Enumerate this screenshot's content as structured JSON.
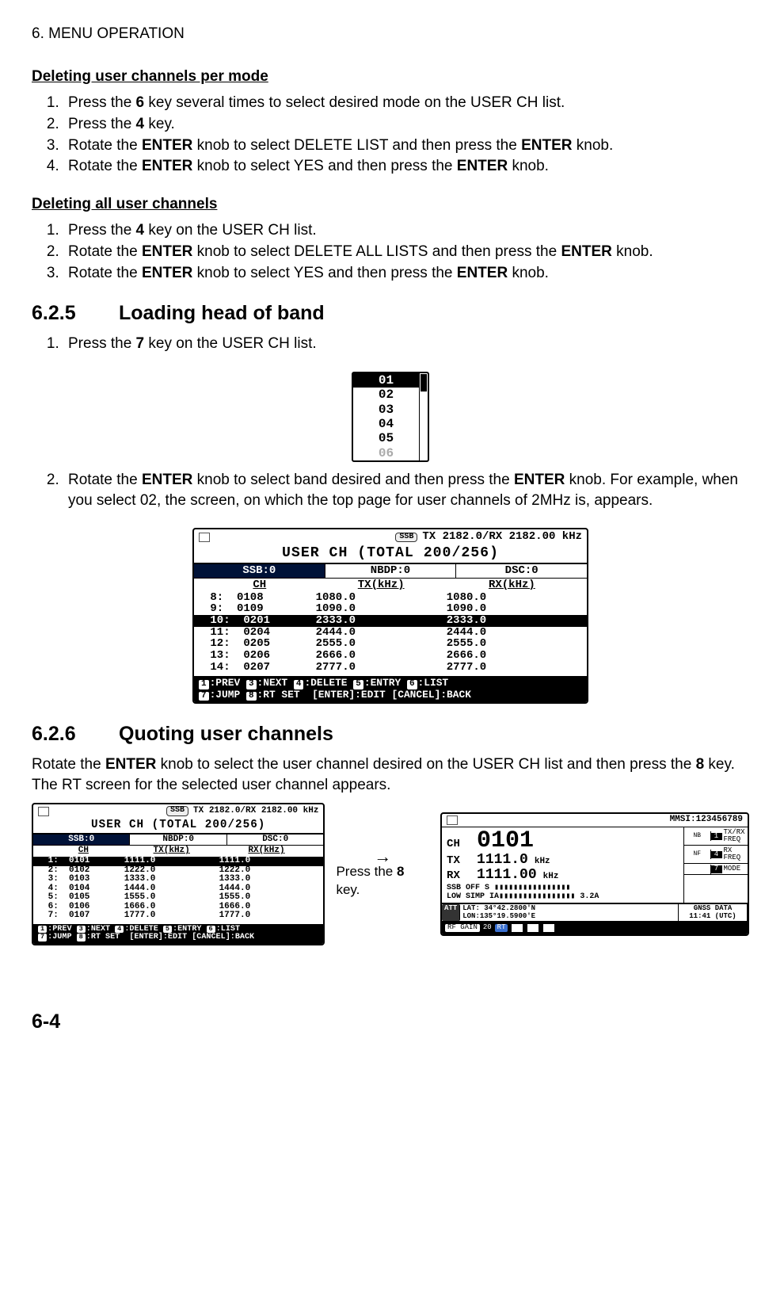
{
  "header": {
    "chapter": "6. MENU OPERATION"
  },
  "sec_per_mode": {
    "title": "Deleting user channels per mode",
    "steps": [
      "Press the <b>6</b> key several times to select desired mode on the USER CH list.",
      "Press the <b>4</b> key.",
      "Rotate the <b>ENTER</b> knob to select DELETE LIST and then press the <b>ENTER</b> knob.",
      "Rotate the <b>ENTER</b> knob to select YES and then press the <b>ENTER</b> knob."
    ]
  },
  "sec_all": {
    "title": "Deleting all user channels",
    "steps": [
      "Press the <b>4</b> key on the USER CH list.",
      "Rotate the <b>ENTER</b> knob to select DELETE ALL LISTS and then press the <b>ENTER</b> knob.",
      "Rotate the <b>ENTER</b> knob to select YES and then press the <b>ENTER</b> knob."
    ]
  },
  "sec_625": {
    "num": "6.2.5",
    "title": "Loading head of band",
    "step1": "Press the <b>7</b> key on the USER CH list.",
    "band_list": [
      "01",
      "02",
      "03",
      "04",
      "05",
      "06"
    ],
    "step2": "Rotate the <b>ENTER</b> knob to select band desired and then press the <b>ENTER</b> knob. For example, when you select 02, the screen, on which the top page for user channels of 2MHz is, appears."
  },
  "lcd_main": {
    "mode_badge": "SSB",
    "topline": "TX 2182.0/RX 2182.00 kHz",
    "title": "USER CH  (TOTAL 200/256)",
    "tabs": [
      "SSB:0",
      "NBDP:0",
      "DSC:0"
    ],
    "headers": [
      "CH",
      "TX(kHz)",
      "RX(kHz)"
    ],
    "rows": [
      {
        "idx": "8:",
        "ch": "0108",
        "tx": "1080.0",
        "rx": "1080.0",
        "sel": false
      },
      {
        "idx": "9:",
        "ch": "0109",
        "tx": "1090.0",
        "rx": "1090.0",
        "sel": false
      },
      {
        "idx": "10:",
        "ch": "0201",
        "tx": "2333.0",
        "rx": "2333.0",
        "sel": true
      },
      {
        "idx": "11:",
        "ch": "0204",
        "tx": "2444.0",
        "rx": "2444.0",
        "sel": false
      },
      {
        "idx": "12:",
        "ch": "0205",
        "tx": "2555.0",
        "rx": "2555.0",
        "sel": false
      },
      {
        "idx": "13:",
        "ch": "0206",
        "tx": "2666.0",
        "rx": "2666.0",
        "sel": false
      },
      {
        "idx": "14:",
        "ch": "0207",
        "tx": "2777.0",
        "rx": "2777.0",
        "sel": false
      }
    ],
    "footer1": [
      [
        "1",
        "PREV"
      ],
      [
        "3",
        "NEXT"
      ],
      [
        "4",
        "DELETE"
      ],
      [
        "5",
        "ENTRY"
      ],
      [
        "6",
        "LIST"
      ]
    ],
    "footer2_a": [
      [
        "7",
        "JUMP"
      ],
      [
        "8",
        "RT SET"
      ]
    ],
    "footer2_b": "[ENTER]:EDIT  [CANCEL]:BACK"
  },
  "sec_626": {
    "num": "6.2.6",
    "title": "Quoting user channels",
    "intro": "Rotate the <b>ENTER</b> knob to select the user channel desired on the USER CH list and then press the <b>8</b> key. The RT screen for the selected user channel appears."
  },
  "lcd_small": {
    "mode_badge": "SSB",
    "topline": "TX 2182.0/RX 2182.00 kHz",
    "title": "USER CH  (TOTAL 200/256)",
    "tabs": [
      "SSB:0",
      "NBDP:0",
      "DSC:0"
    ],
    "headers": [
      "CH",
      "TX(kHz)",
      "RX(kHz)"
    ],
    "rows": [
      {
        "idx": "1:",
        "ch": "0101",
        "tx": "1111.0",
        "rx": "1111.0",
        "sel": true
      },
      {
        "idx": "2:",
        "ch": "0102",
        "tx": "1222.0",
        "rx": "1222.0",
        "sel": false
      },
      {
        "idx": "3:",
        "ch": "0103",
        "tx": "1333.0",
        "rx": "1333.0",
        "sel": false
      },
      {
        "idx": "4:",
        "ch": "0104",
        "tx": "1444.0",
        "rx": "1444.0",
        "sel": false
      },
      {
        "idx": "5:",
        "ch": "0105",
        "tx": "1555.0",
        "rx": "1555.0",
        "sel": false
      },
      {
        "idx": "6:",
        "ch": "0106",
        "tx": "1666.0",
        "rx": "1666.0",
        "sel": false
      },
      {
        "idx": "7:",
        "ch": "0107",
        "tx": "1777.0",
        "rx": "1777.0",
        "sel": false
      }
    ],
    "footer1": [
      [
        "1",
        "PREV"
      ],
      [
        "3",
        "NEXT"
      ],
      [
        "4",
        "DELETE"
      ],
      [
        "5",
        "ENTRY"
      ],
      [
        "6",
        "LIST"
      ]
    ],
    "footer2_a": [
      [
        "7",
        "JUMP"
      ],
      [
        "8",
        "RT SET"
      ]
    ],
    "footer2_b": "[ENTER]:EDIT  [CANCEL]:BACK"
  },
  "arrow_text": "Press the <b>8</b> key.",
  "rt_screen": {
    "mmsi": "MMSI:123456789",
    "ch_label": "CH",
    "ch": "0101",
    "tx_label": "TX",
    "tx": "1111.0",
    "rx_label": "RX",
    "rx": "1111.00",
    "unit": "kHz",
    "side_buttons": [
      {
        "n": "1",
        "l1": "TX/RX",
        "l2": "FREQ",
        "badge": "NB"
      },
      {
        "n": "4",
        "l1": "RX",
        "l2": "FREQ",
        "badge": "NF"
      },
      {
        "n": "7",
        "l1": "MODE",
        "l2": "",
        "badge": ""
      }
    ],
    "status1": "SSB  OFF   S ▮▮▮▮▮▮▮▮▮▮▮▮▮▮▮▮",
    "status2": "LOW  SIMP  IA▮▮▮▮▮▮▮▮▮▮▮▮▮▮▮▮ 3.2A",
    "lat": "LAT: 34°42.2800'N",
    "lon": "LON:135°19.5900'E",
    "gnss": "GNSS DATA",
    "time": "11:41 (UTC)",
    "att": "ATT",
    "rfgain": "RF GAIN",
    "rfgain_val": "20",
    "rt": "RT"
  },
  "page_number": "6-4"
}
